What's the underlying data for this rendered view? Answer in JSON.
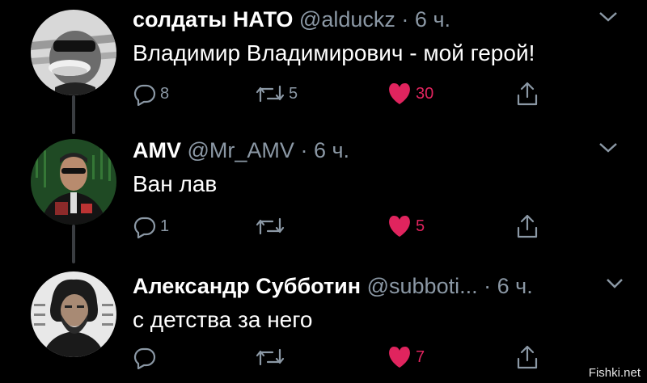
{
  "tweets": [
    {
      "name": "солдаты НАТО",
      "handle": "@alduckz",
      "dot": "·",
      "time": "6 ч.",
      "text": "Владимир Владимирович - мой герой!",
      "replies": "8",
      "retweets": "5",
      "likes": "30",
      "avatar": "duck-avatar"
    },
    {
      "name": "AMV",
      "handle": "@Mr_AMV",
      "dot": "·",
      "time": "6 ч.",
      "text": "Ван лав",
      "replies": "1",
      "retweets": "",
      "likes": "5",
      "avatar": "man-in-suit-avatar"
    },
    {
      "name": "Александр Субботин",
      "handle": "@subboti...",
      "dot": "·",
      "time": "6 ч.",
      "text": "с детства за него",
      "replies": "",
      "retweets": "",
      "likes": "7",
      "avatar": "bearded-man-avatar"
    }
  ],
  "colors": {
    "background": "#000000",
    "secondary": "#8b98a5",
    "like": "#e0245e",
    "thread": "#3a3d41"
  },
  "watermark": "Fishki.net"
}
